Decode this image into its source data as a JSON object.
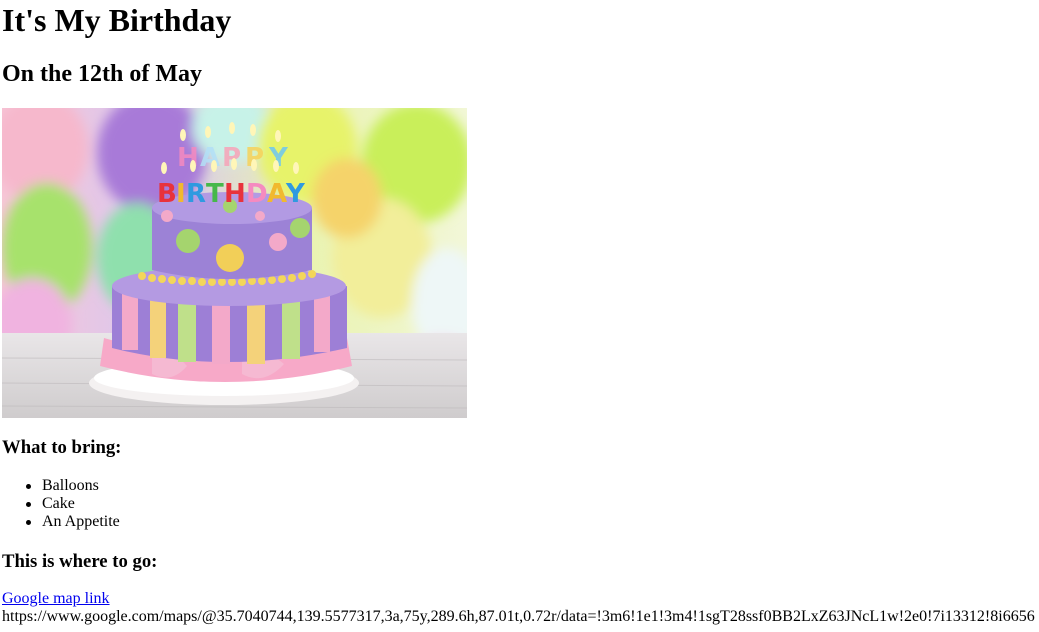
{
  "page": {
    "title": "It's My Birthday",
    "subtitle": "On the 12th of May"
  },
  "image": {
    "description_icon": "birthday-cake-photo",
    "candle_letters_top": "HAPPY",
    "candle_letters_bottom": "BIRTHDAY"
  },
  "bring": {
    "heading": "What to bring:",
    "items": [
      "Balloons",
      "Cake",
      "An Appetite"
    ]
  },
  "location": {
    "heading": "This is where to go:",
    "link_text": "Google map link",
    "url_text": "https://www.google.com/maps/@35.7040744,139.5577317,3a,75y,289.6h,87.01t,0.72r/data=!3m6!1e1!3m4!1sgT28ssf0BB2LxZ63JNcL1w!2e0!7i13312!8i6656"
  },
  "colors": {
    "link": "#0000ee",
    "text": "#000000",
    "background": "#ffffff"
  }
}
